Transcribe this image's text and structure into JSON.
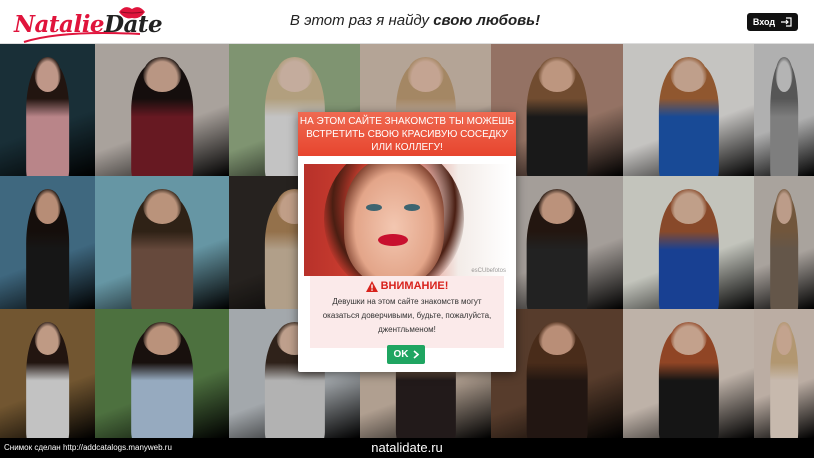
{
  "header": {
    "logo_text_1": "Natalie",
    "logo_text_2": "Date",
    "tagline_plain": "В этот раз я найду ",
    "tagline_bold": "свою любовь!",
    "login_label": "Вход"
  },
  "gallery": {
    "photos": [
      {
        "bg": "#1f3a44",
        "skin": "#e9b9a6",
        "dress": "#e2a3a8",
        "hair": "#2a1a14"
      },
      {
        "bg": "#cfc6bf",
        "skin": "#e2b7a0",
        "dress": "#7e1f2a",
        "hair": "#1a1210"
      },
      {
        "bg": "#9bb58a",
        "skin": "#efd2c0",
        "dress": "#eeeeee",
        "hair": "#d9c39a"
      },
      {
        "bg": "#dcc8b8",
        "skin": "#f0c9b2",
        "dress": "#e9d4c6",
        "hair": "#c9a57a"
      },
      {
        "bg": "#b58c7a",
        "skin": "#e7b89c",
        "dress": "#1f1f1f",
        "hair": "#8a5d3b"
      },
      {
        "bg": "#f1efec",
        "skin": "#e9c2aa",
        "dress": "#1e5bb8",
        "hair": "#b06b3a"
      },
      {
        "bg": "#d7d7d7",
        "skin": "#dcdcdc",
        "dress": "#9a9a9a",
        "hair": "#6a6a6a"
      },
      {
        "bg": "#4d7f9c",
        "skin": "#e0ad90",
        "dress": "#1c1c1c",
        "hair": "#1a120e"
      },
      {
        "bg": "#7db8c9",
        "skin": "#e3b497",
        "dress": "#7d5a4a",
        "hair": "#3a2a1c"
      },
      {
        "bg": "#2f2a26",
        "skin": "#ebc1a5",
        "dress": "#d8c3a8",
        "hair": "#b58a5c"
      },
      {
        "bg": "#cfcfcf",
        "skin": "#e5b99e",
        "dress": "#c7b2a2",
        "hair": "#a07450"
      },
      {
        "bg": "#c9c1bb",
        "skin": "#e4b397",
        "dress": "#2a2a2a",
        "hair": "#2b1c14"
      },
      {
        "bg": "#eef0e6",
        "skin": "#ebc3a8",
        "dress": "#1e4fb3",
        "hair": "#a65a34"
      },
      {
        "bg": "#cfc7c0",
        "skin": "#e6bfa8",
        "dress": "#7a6a5a",
        "hair": "#8a6a4a"
      },
      {
        "bg": "#8c6a3c",
        "skin": "#e9bca2",
        "dress": "#ededed",
        "hair": "#2a1a14"
      },
      {
        "bg": "#5f8a4e",
        "skin": "#e3b296",
        "dress": "#b7d0ea",
        "hair": "#1e1410"
      },
      {
        "bg": "#c7cdd2",
        "skin": "#e8c3ab",
        "dress": "#d9d9d9",
        "hair": "#3a2a20"
      },
      {
        "bg": "#d7c2b0",
        "skin": "#efc7ae",
        "dress": "#2a2020",
        "hair": "#c9a27a"
      },
      {
        "bg": "#6b4a36",
        "skin": "#e2ae92",
        "dress": "#2a1c16",
        "hair": "#5a3620"
      },
      {
        "bg": "#e8d9cd",
        "skin": "#eec5ab",
        "dress": "#1a1a1a",
        "hair": "#b0552e"
      },
      {
        "bg": "#e4d3c7",
        "skin": "#eec7ae",
        "dress": "#f3e2d4",
        "hair": "#d9b98a"
      }
    ]
  },
  "modal": {
    "headline": "На этом сайте знакомств ты можешь встретить свою красивую соседку или коллегу!",
    "watermark": "esCUbefotos",
    "warning_title": "ВНИМАНИЕ!",
    "warning_text": "Девушки на этом сайте знакомств могут оказаться доверчивыми, будьте, пожалуйста, джентльменом!",
    "ok_label": "OK"
  },
  "footer": {
    "snapshot_text": "Снимок сделан http://addcatalogs.manyweb.ru",
    "domain": "natalidate.ru"
  },
  "colors": {
    "brand_red": "#e0143c",
    "modal_header": "#e7452e",
    "ok_green": "#1fa561",
    "warning_red": "#d8221c"
  },
  "icons": {
    "logo_mark": "lips-icon",
    "login": "sign-in-icon",
    "warning": "warning-triangle-icon",
    "ok": "chevron-right-icon"
  }
}
